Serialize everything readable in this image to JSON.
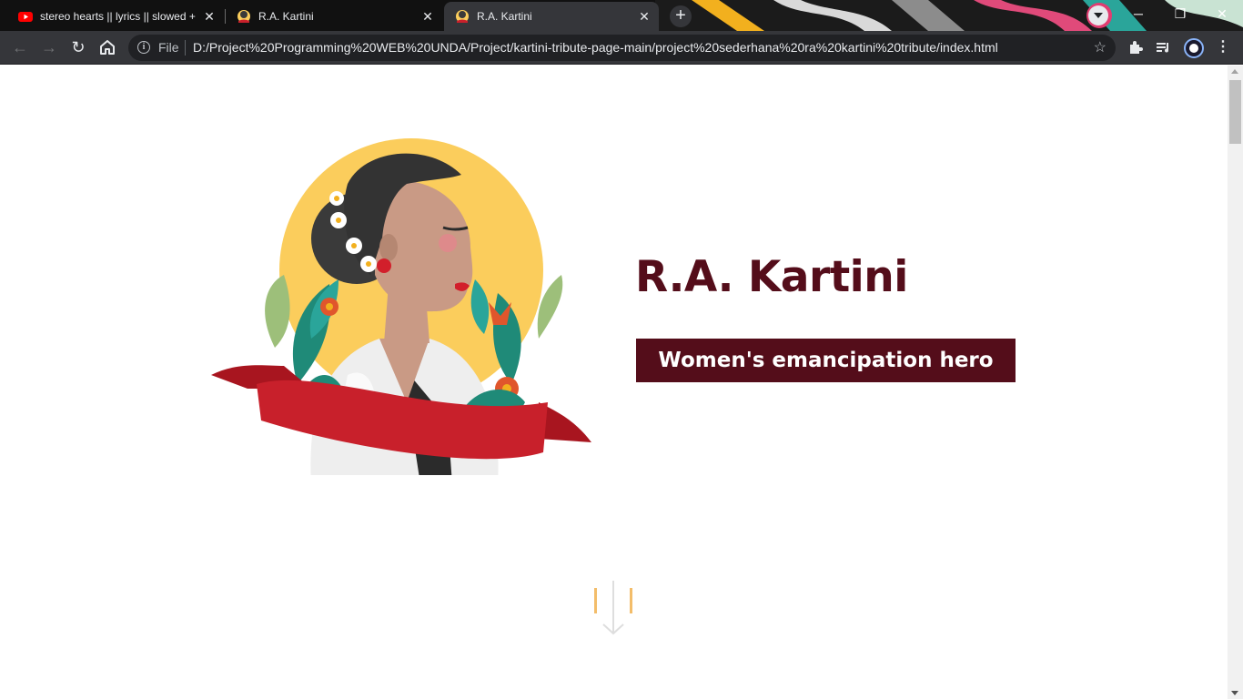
{
  "browser": {
    "tabs": [
      {
        "title": "stereo hearts || lyrics || slowed + r",
        "favicon": "youtube-icon",
        "active": false
      },
      {
        "title": "R.A. Kartini",
        "favicon": "kartini-favicon",
        "active": false
      },
      {
        "title": "R.A. Kartini",
        "favicon": "kartini-favicon",
        "active": true
      }
    ],
    "new_tab_label": "+",
    "close_glyph": "✕",
    "window_buttons": {
      "minimize": "─",
      "restore": "❐",
      "close": "✕"
    },
    "address": {
      "scheme_label": "File",
      "url": "D:/Project%20Programming%20WEB%20UNDA/Project/kartini-tribute-page-main/project%20sederhana%20ra%20kartini%20tribute/index.html"
    },
    "icons": [
      "back-icon",
      "forward-icon",
      "reload-icon",
      "home-icon",
      "info-icon",
      "bookmark-star-icon",
      "extensions-icon",
      "media-queue-icon",
      "profile-icon",
      "menu-icon"
    ]
  },
  "page": {
    "hero": {
      "name": "R.A. Kartini",
      "tagline": "Women's emancipation hero"
    },
    "colors": {
      "brand": "#540d1a",
      "accent_yellow": "#fbcd5c",
      "ribbon_red": "#c8202b",
      "scroll_arrow_accent": "#f3bd6a"
    }
  }
}
